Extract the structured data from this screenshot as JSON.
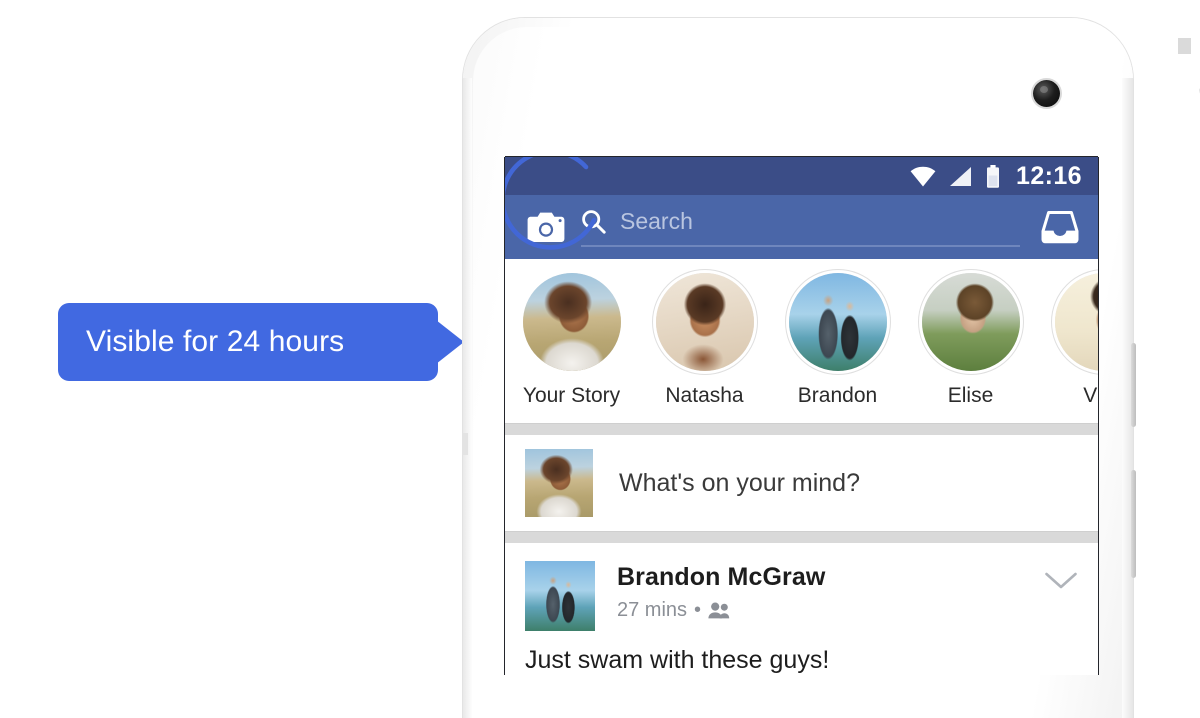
{
  "callout": {
    "label": "Visible for 24 hours",
    "color": "#4169e1",
    "text_color": "#ffffff",
    "arrow_direction": "right"
  },
  "device": {
    "type": "android-phone",
    "body_color": "#ffffff",
    "components": {
      "front_camera": "camera-icon",
      "earpiece": "speaker-grille",
      "sensor": "proximity-sensor",
      "power_button": "power-button",
      "volume_button": "volume-button"
    }
  },
  "screen": {
    "statusbar": {
      "time": "12:16",
      "background": "#3b4d87",
      "icons": [
        "wifi-icon",
        "cellular-signal-icon",
        "battery-icon"
      ]
    },
    "header": {
      "background": "#4a66a8",
      "camera_icon": "camera-icon",
      "search": {
        "icon": "search-icon",
        "placeholder": "Search",
        "value": ""
      },
      "messenger_icon": "messenger-inbox-icon"
    },
    "stories": [
      {
        "name": "Your Story",
        "has_ring": true,
        "ring_color": "#4267d6",
        "avatar": "ph-you"
      },
      {
        "name": "Natasha",
        "has_ring": false,
        "ring_color": "",
        "avatar": "ph-natasha"
      },
      {
        "name": "Brandon",
        "has_ring": false,
        "ring_color": "",
        "avatar": "ph-brandon"
      },
      {
        "name": "Elise",
        "has_ring": false,
        "ring_color": "",
        "avatar": "ph-elise"
      },
      {
        "name": "Vinc",
        "has_ring": false,
        "ring_color": "",
        "avatar": "ph-vince"
      }
    ],
    "composer": {
      "prompt": "What's on your mind?",
      "avatar": "ph-you"
    },
    "post": {
      "author": "Brandon McGraw",
      "timestamp": "27 mins",
      "separator": "•",
      "audience_icon": "friends-icon",
      "menu_icon": "chevron-down-icon",
      "body": "Just swam with these guys!",
      "avatar": "ph-brandon"
    }
  }
}
